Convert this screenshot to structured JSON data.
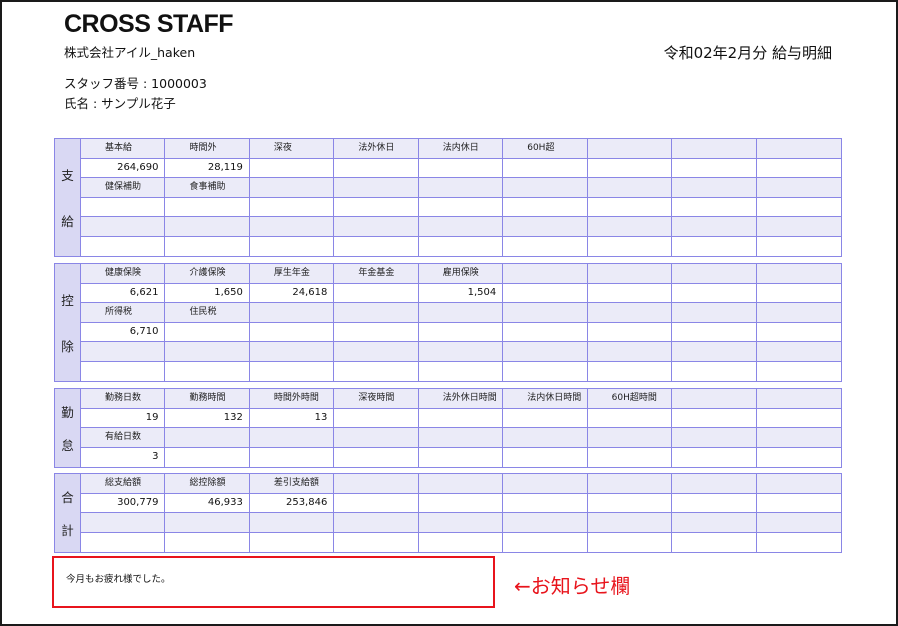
{
  "header": {
    "logo": "CROSS STAFF",
    "company": "株式会社アイル_haken",
    "staff_number": "スタッフ番号 : 1000003",
    "staff_name": "氏名 : サンプル花子",
    "title": "令和02年2月分 給与明細"
  },
  "sections": [
    {
      "id": "payments",
      "label": [
        "支",
        "給"
      ],
      "rows": [
        [
          "基本給",
          "時間外",
          "深夜",
          "法外休日",
          "法内休日",
          "60H超",
          "",
          "",
          ""
        ],
        [
          "264,690",
          "28,119",
          "",
          "",
          "",
          "",
          "",
          "",
          ""
        ],
        [
          "健保補助",
          "食事補助",
          "",
          "",
          "",
          "",
          "",
          "",
          ""
        ],
        [
          "",
          "",
          "",
          "",
          "",
          "",
          "",
          "",
          ""
        ],
        [
          "",
          "",
          "",
          "",
          "",
          "",
          "",
          "",
          ""
        ],
        [
          "",
          "",
          "",
          "",
          "",
          "",
          "",
          "",
          ""
        ]
      ]
    },
    {
      "id": "deductions",
      "label": [
        "控",
        "除"
      ],
      "rows": [
        [
          "健康保険",
          "介護保険",
          "厚生年金",
          "年金基金",
          "雇用保険",
          "",
          "",
          "",
          ""
        ],
        [
          "6,621",
          "1,650",
          "24,618",
          "",
          "1,504",
          "",
          "",
          "",
          ""
        ],
        [
          "所得税",
          "住民税",
          "",
          "",
          "",
          "",
          "",
          "",
          ""
        ],
        [
          "6,710",
          "",
          "",
          "",
          "",
          "",
          "",
          "",
          ""
        ],
        [
          "",
          "",
          "",
          "",
          "",
          "",
          "",
          "",
          ""
        ],
        [
          "",
          "",
          "",
          "",
          "",
          "",
          "",
          "",
          ""
        ]
      ]
    },
    {
      "id": "attendance",
      "label": [
        "勤",
        "怠"
      ],
      "rows": [
        [
          "勤務日数",
          "勤務時間",
          "時間外時間",
          "深夜時間",
          "法外休日時間",
          "法内休日時間",
          "60H超時間",
          "",
          ""
        ],
        [
          "19",
          "132",
          "13",
          "",
          "",
          "",
          "",
          "",
          ""
        ],
        [
          "有給日数",
          "",
          "",
          "",
          "",
          "",
          "",
          "",
          ""
        ],
        [
          "3",
          "",
          "",
          "",
          "",
          "",
          "",
          "",
          ""
        ]
      ]
    },
    {
      "id": "totals",
      "label": [
        "合",
        "計"
      ],
      "rows": [
        [
          "総支給額",
          "総控除額",
          "差引支給額",
          "",
          "",
          "",
          "",
          "",
          ""
        ],
        [
          "300,779",
          "46,933",
          "253,846",
          "",
          "",
          "",
          "",
          "",
          ""
        ],
        [
          "",
          "",
          "",
          "",
          "",
          "",
          "",
          "",
          ""
        ],
        [
          "",
          "",
          "",
          "",
          "",
          "",
          "",
          "",
          ""
        ]
      ]
    }
  ],
  "notice": {
    "message": "今月もお疲れ様でした。",
    "annotation": "←お知らせ欄"
  },
  "colors": {
    "border": "#8a86e6",
    "label_bg": "#d9d8f3",
    "header_bg": "#ebebf8",
    "notice_border": "#e8141c"
  }
}
